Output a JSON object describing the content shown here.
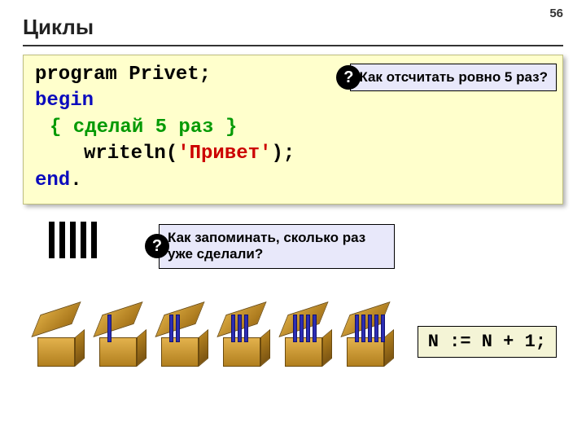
{
  "page_number": "56",
  "title": "Циклы",
  "code": {
    "l1a": "program",
    "l1b": " Privet;",
    "l2": "begin",
    "l3": "{ сделай 5 раз }",
    "l4a": "writeln(",
    "l4b": "'Привет'",
    "l4c": ");",
    "l5a": "end",
    "l5b": "."
  },
  "question_badge": "?",
  "callout1": "Как отсчитать ровно 5 раз?",
  "callout2": "Как запоминать, сколько раз уже сделали?",
  "formula": "N := N + 1;",
  "boxes_sticks": [
    0,
    1,
    2,
    3,
    4,
    5
  ]
}
